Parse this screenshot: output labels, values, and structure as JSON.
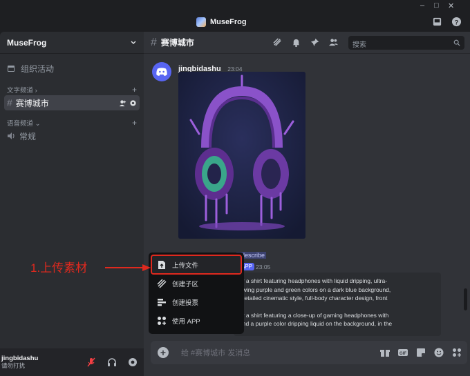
{
  "app": {
    "title": "MuseFrog"
  },
  "window_controls": {
    "minimize": "–",
    "maximize": "□",
    "close": "✕"
  },
  "server": {
    "name": "MuseFrog"
  },
  "sidebar": {
    "events_label": "组织活动",
    "text_category": "文字频道",
    "active_channel": "赛博城市",
    "voice_category": "语音频道",
    "voice_channel": "常规"
  },
  "channel": {
    "name": "赛博城市"
  },
  "search": {
    "placeholder": "搜索"
  },
  "message": {
    "author": "jingbidashu",
    "time": "23:04"
  },
  "second_message": {
    "command": "/ describe",
    "tag": "APP",
    "time": "23:05",
    "line1": "or a shirt featuring headphones with liquid dripping, ultra-",
    "line2": "owing purple and green colors on a dark blue background,",
    "line3": "-detailed cinematic style, full-body character design, front",
    "line4": "or a shirt featuring a close-up of gaming headphones with",
    "line5": "and a purple color dripping liquid on the background, in the"
  },
  "popup": {
    "items": [
      {
        "label": "上传文件",
        "icon": "upload-file-icon"
      },
      {
        "label": "创建子区",
        "icon": "thread-icon"
      },
      {
        "label": "创建投票",
        "icon": "poll-icon"
      },
      {
        "label": "使用 APP",
        "icon": "apps-icon"
      }
    ]
  },
  "annotation": {
    "text": "1.上传素材"
  },
  "composer": {
    "plus": "+",
    "placeholder": "给 #赛博城市 发消息"
  },
  "user": {
    "name": "jingbidashu",
    "status": "请勿打扰"
  },
  "colors": {
    "accent": "#5865f2",
    "annotation": "#e0291e"
  }
}
